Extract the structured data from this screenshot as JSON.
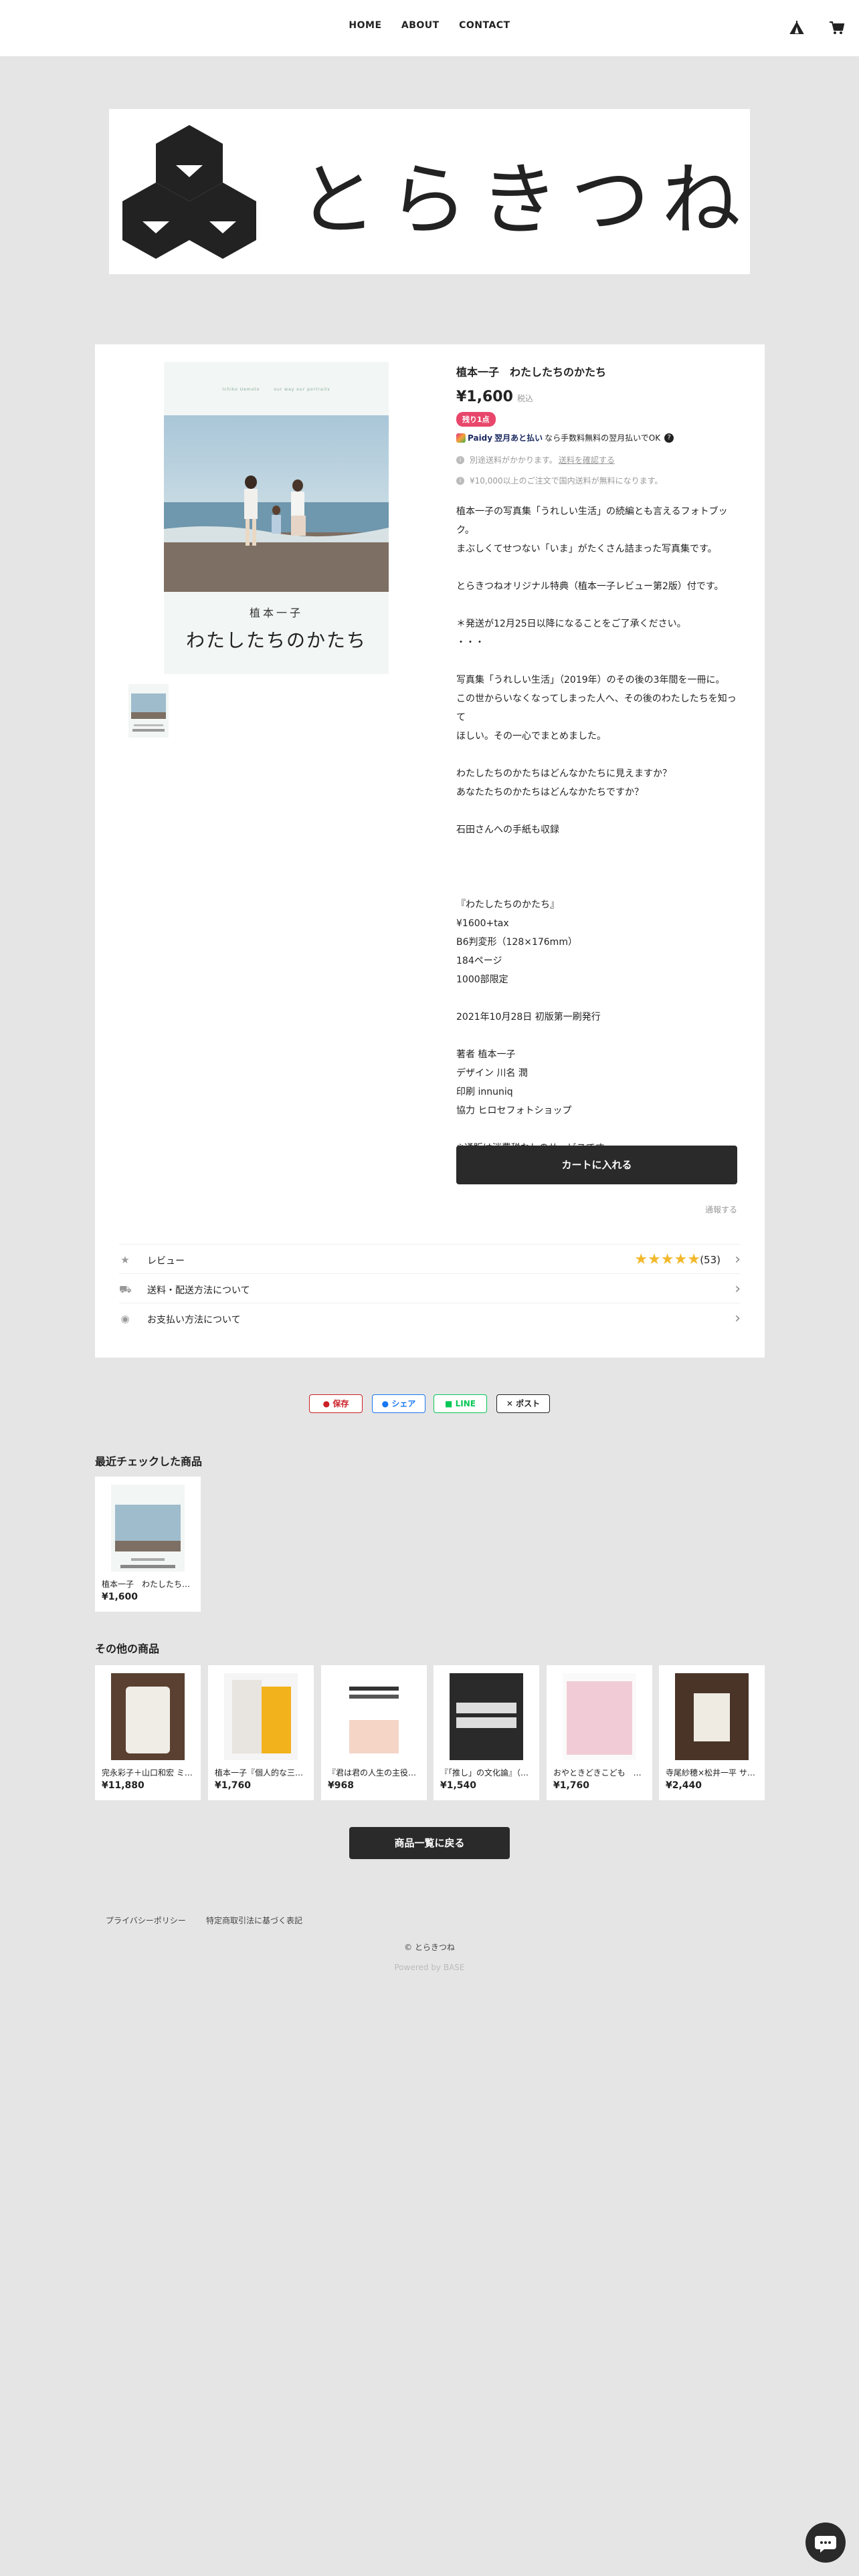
{
  "header": {
    "nav": [
      "HOME",
      "ABOUT",
      "CONTACT"
    ],
    "icons": [
      "tent-icon",
      "cart-icon"
    ]
  },
  "shop": {
    "logo_text": "とらきつね"
  },
  "product": {
    "title": "植本一子　わたしたちのかたち",
    "price": "¥1,600",
    "tax_label": "税込",
    "badge": "残り1点",
    "cover_header": "Ichiko Uemoto　　　our way our portraits",
    "cover_author": "植本一子",
    "cover_title": "わたしたちのかたち",
    "paidy_brand": "Paidy",
    "paidy_text": "翌月あと払い",
    "paidy_suffix": "なら手数料無料の翌月払いでOK",
    "shipping_note_prefix": "別途送料がかかります。",
    "shipping_note_link": "送料を確認する",
    "free_shipping_note": "¥10,000以上のご注文で国内送料が無料になります。",
    "description": [
      "植本一子の写真集「うれしい生活」の続編とも言えるフォトブック。",
      "まぶしくてせつない「いま」がたくさん詰まった写真集です。",
      "",
      "とらきつねオリジナル特典（植本一子レビュー第2版）付です。",
      "",
      "＊発送が12月25日以降になることをご了承ください。",
      "・・・",
      "",
      "写真集「うれしい生活」（2019年）のその後の3年間を一冊に。",
      "この世からいなくなってしまった人へ、その後のわたしたちを知って",
      "ほしい。その一心でまとめました。",
      "",
      "わたしたちのかたちはどんなかたちに見えますか？",
      "あなたたちのかたちはどんなかたちですか？",
      "",
      "石田さんへの手紙も収録",
      "",
      "",
      "",
      "『わたしたちのかたち』",
      "¥1600+tax",
      "B6判変形（128×176mm）",
      "184ページ",
      "1000部限定",
      "",
      "2021年10月28日 初版第一刷発行",
      "",
      "著者 植本一子",
      "デザイン 川名 潤",
      "印刷 innuniq",
      "協力 ヒロセフォトショップ",
      "",
      "※通販は消費税なしのサービスです"
    ],
    "cart_button": "カートに入れる",
    "notify_link": "通報する",
    "rows": [
      {
        "label": "レビュー",
        "icon": "star-icon"
      },
      {
        "label": "送料・配送方法について",
        "icon": "truck-icon"
      },
      {
        "label": "お支払い方法について",
        "icon": "coin-icon"
      }
    ],
    "review_rating": 5,
    "review_count": "(53)"
  },
  "share": {
    "save": "保存",
    "share": "シェア",
    "line": "LINE",
    "post": "ポスト"
  },
  "recent": {
    "title": "最近チェックした商品",
    "item": {
      "name": "植本一子　わたしたちのかたち",
      "price": "¥1,600"
    }
  },
  "others": {
    "title": "その他の商品",
    "items": [
      {
        "name": "完永彩子＋山口和宏 ミニアートキャンバス",
        "price": "¥11,880"
      },
      {
        "name": "植本一子『個人的な三月』",
        "price": "¥1,760"
      },
      {
        "name": "『君は君の人生の主役になれ』",
        "price": "¥968"
      },
      {
        "name": "『「推し」の文化論』（鳥羽和久）",
        "price": "¥1,540"
      },
      {
        "name": "おやときどきこども　鳥羽和久",
        "price": "¥1,760"
      },
      {
        "name": "寺尾紗穂×松井一平 サコッシュ",
        "price": "¥2,440"
      }
    ]
  },
  "back_button": "商品一覧に戻る",
  "footer": {
    "privacy": "プライバシーポリシー",
    "tokushoho": "特定商取引法に基づく表記",
    "copyright": "© とらきつね",
    "powered": "Powered by BASE"
  },
  "colors": {
    "page_bg": "#e5e5e5",
    "button_dark": "#2a2a2a",
    "badge": "#e8476b",
    "star": "#f2b82c",
    "pinterest": "#cb2027",
    "facebook": "#1877f2",
    "line": "#06c755"
  }
}
